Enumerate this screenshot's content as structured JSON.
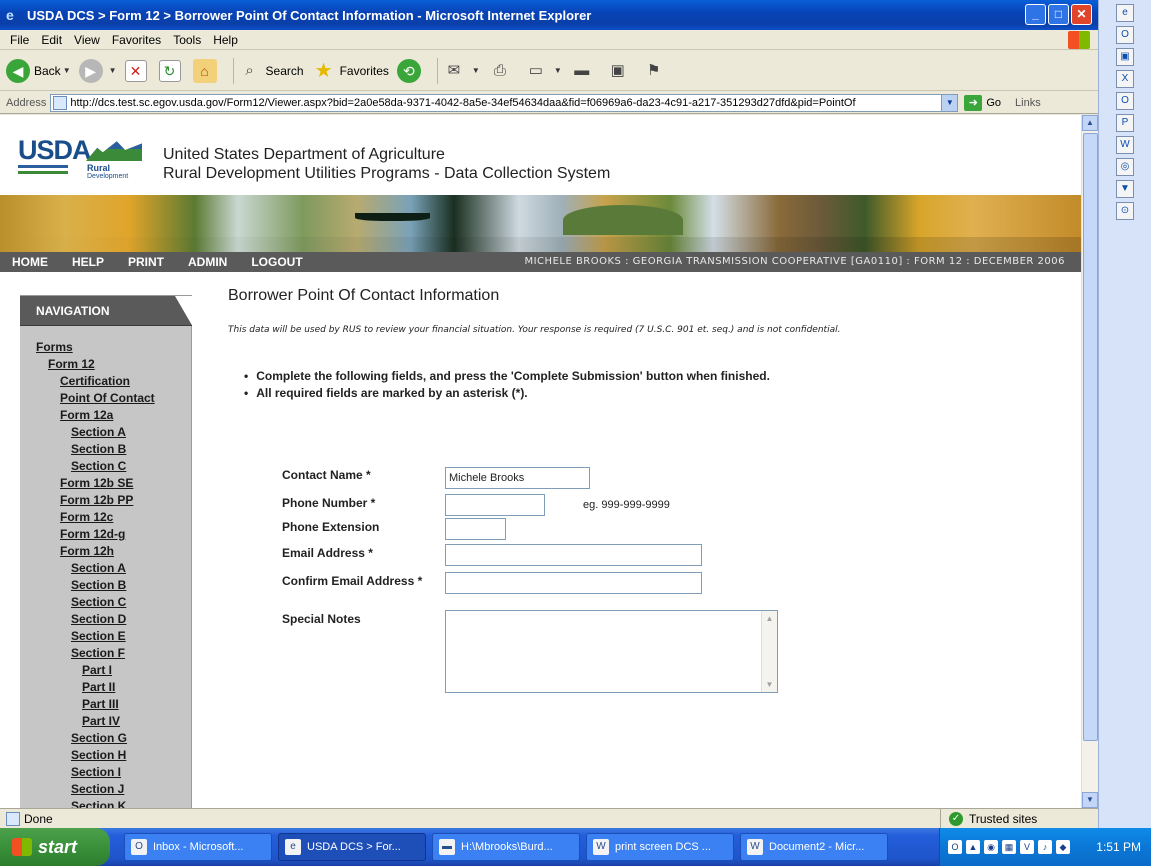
{
  "window": {
    "title": "USDA DCS > Form 12 > Borrower Point Of Contact Information - Microsoft Internet Explorer"
  },
  "menu": [
    "File",
    "Edit",
    "View",
    "Favorites",
    "Tools",
    "Help"
  ],
  "toolbar": {
    "back": "Back",
    "search": "Search",
    "favorites": "Favorites"
  },
  "address": {
    "label": "Address",
    "url": "http://dcs.test.sc.egov.usda.gov/Form12/Viewer.aspx?bid=2a0e58da-9371-4042-8a5e-34ef54634daa&fid=f06969a6-da23-4c91-a217-351293d27dfd&pid=PointOf",
    "go": "Go",
    "links": "Links"
  },
  "header": {
    "logo_usda": "USDA",
    "logo_rural": "Rural",
    "logo_dev": "Development",
    "title1": "United States Department of Agriculture",
    "title2": "Rural Development Utilities Programs - Data Collection System"
  },
  "navbar": {
    "items": [
      "HOME",
      "HELP",
      "PRINT",
      "ADMIN",
      "LOGOUT"
    ],
    "user_info": "MICHELE BROOKS : GEORGIA TRANSMISSION COOPERATIVE [GA0110] : FORM 12 : DECEMBER 2006"
  },
  "nav": {
    "title": "NAVIGATION",
    "items": [
      {
        "label": "Forms",
        "indent": 0
      },
      {
        "label": "Form 12",
        "indent": 1
      },
      {
        "label": "Certification",
        "indent": 2
      },
      {
        "label": "Point Of Contact",
        "indent": 2
      },
      {
        "label": "Form 12a",
        "indent": 2
      },
      {
        "label": "Section A",
        "indent": 3
      },
      {
        "label": "Section B",
        "indent": 3
      },
      {
        "label": "Section C",
        "indent": 3
      },
      {
        "label": "Form 12b SE",
        "indent": 2
      },
      {
        "label": "Form 12b PP",
        "indent": 2
      },
      {
        "label": "Form 12c",
        "indent": 2
      },
      {
        "label": "Form 12d-g",
        "indent": 2
      },
      {
        "label": "Form 12h",
        "indent": 2
      },
      {
        "label": "Section A",
        "indent": 3
      },
      {
        "label": "Section B",
        "indent": 3
      },
      {
        "label": "Section C",
        "indent": 3
      },
      {
        "label": "Section D",
        "indent": 3
      },
      {
        "label": "Section E",
        "indent": 3
      },
      {
        "label": "Section F",
        "indent": 3
      },
      {
        "label": "Part I",
        "indent": 4
      },
      {
        "label": "Part II",
        "indent": 4
      },
      {
        "label": "Part III",
        "indent": 4
      },
      {
        "label": "Part IV",
        "indent": 4
      },
      {
        "label": "Section G",
        "indent": 3
      },
      {
        "label": "Section H",
        "indent": 3
      },
      {
        "label": "Section I",
        "indent": 3
      },
      {
        "label": "Section J",
        "indent": 3
      },
      {
        "label": "Section K",
        "indent": 3
      }
    ]
  },
  "main": {
    "heading": "Borrower Point Of Contact Information",
    "disclaimer": "This data will be used by RUS to review your financial situation. Your response is required (7 U.S.C. 901 et. seq.) and is not confidential.",
    "bullets": [
      "Complete the following fields, and press the 'Complete Submission' button when finished.",
      "All required fields are marked by an asterisk (*)."
    ],
    "fields": {
      "contact_name": {
        "label": "Contact Name *",
        "value": "Michele Brooks"
      },
      "phone": {
        "label": "Phone Number *",
        "value": "",
        "hint": "eg. 999-999-9999"
      },
      "extension": {
        "label": "Phone Extension",
        "value": ""
      },
      "email": {
        "label": "Email Address *",
        "value": ""
      },
      "confirm_email": {
        "label": "Confirm Email Address *",
        "value": ""
      },
      "notes": {
        "label": "Special Notes",
        "value": ""
      }
    }
  },
  "status": {
    "text": "Done",
    "zone": "Trusted sites"
  },
  "taskbar": {
    "start": "start",
    "tasks": [
      "Inbox - Microsoft...",
      "USDA DCS > For...",
      "H:\\Mbrooks\\Burd...",
      "print screen DCS ...",
      "Document2 - Micr..."
    ],
    "clock": "1:51 PM"
  }
}
